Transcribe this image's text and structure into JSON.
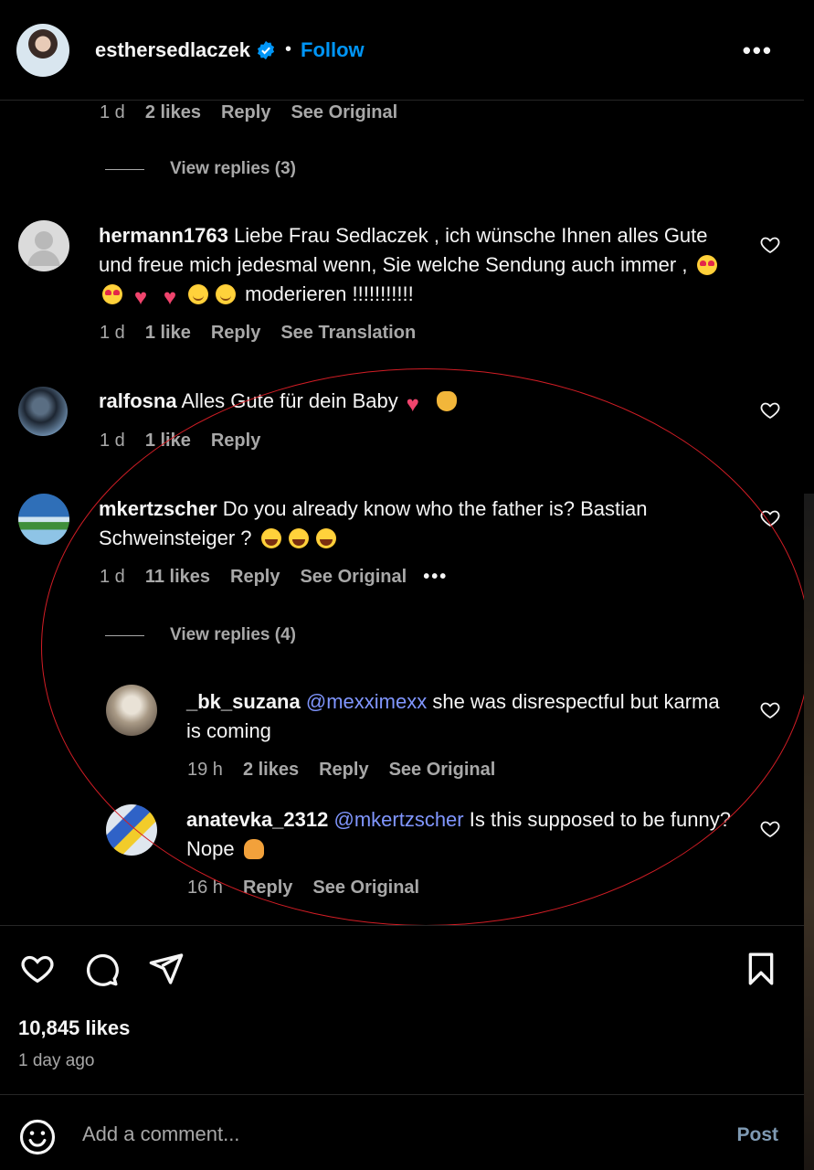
{
  "header": {
    "username": "esthersedlaczek",
    "separator": "•",
    "follow_label": "Follow",
    "more_label": "•••"
  },
  "top_meta": {
    "time": "1 d",
    "likes": "2 likes",
    "reply": "Reply",
    "see": "See Original"
  },
  "view_replies_1": "View replies (3)",
  "comments": [
    {
      "user": "hermann1763",
      "text_a": "Liebe Frau Sedlaczek , ich wünsche Ihnen alles Gute und freue mich jedesmal wenn, Sie welche Sendung auch immer ,",
      "text_b": "moderieren !!!!!!!!!!!",
      "time": "1 d",
      "likes": "1 like",
      "reply": "Reply",
      "see": "See Translation"
    },
    {
      "user": "ralfosna",
      "text_a": "Alles Gute für dein Baby",
      "time": "1 d",
      "likes": "1 like",
      "reply": "Reply"
    },
    {
      "user": "mkertzscher",
      "text_a": "Do you already know who the father is? Bastian Schweinsteiger ?",
      "time": "1 d",
      "likes": "11 likes",
      "reply": "Reply",
      "see": "See Original",
      "more": "•••"
    }
  ],
  "view_replies_2": "View replies (4)",
  "replies": [
    {
      "user": "_bk_suzana",
      "mention": "@mexximexx",
      "text": "she was disrespectful but karma is coming",
      "time": "19 h",
      "likes": "2 likes",
      "reply": "Reply",
      "see": "See Original"
    },
    {
      "user": "anatevka_2312",
      "mention": "@mkertzscher",
      "text": "Is this supposed to be funny? Nope",
      "time": "16 h",
      "reply": "Reply",
      "see": "See Original"
    }
  ],
  "post": {
    "likes": "10,845 likes",
    "time_ago": "1 day ago",
    "comment_placeholder": "Add a comment...",
    "post_label": "Post"
  },
  "icons": [
    "verified-badge-icon",
    "heart-icon",
    "comment-icon",
    "share-icon",
    "bookmark-icon",
    "emoji-icon"
  ],
  "colors": {
    "accent": "#0095f6",
    "mention": "#8096ff",
    "annotation": "#d21d25"
  }
}
